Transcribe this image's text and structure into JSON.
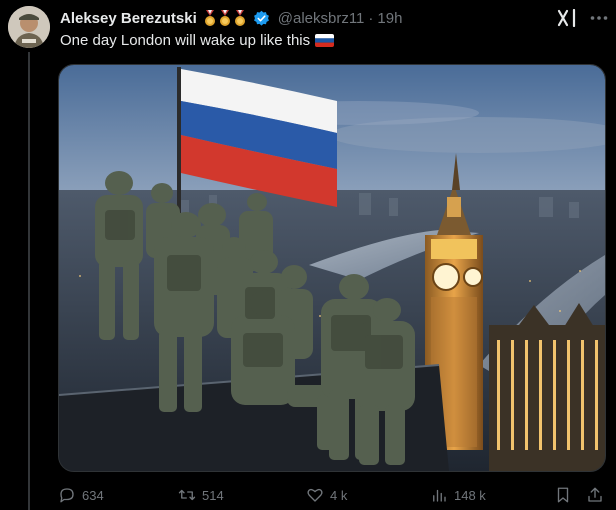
{
  "post": {
    "author_name": "Aleksey Berezutski",
    "handle": "@aleksbrz11",
    "separator": "·",
    "time": "19h",
    "text": "One day London will wake up like this",
    "text_flag_icon": "russian-flag-emoji",
    "badges": [
      "medal-icon",
      "medal-icon",
      "medal-icon"
    ],
    "verified_icon": "verified-badge-icon"
  },
  "image": {
    "description_icon": "ai-generated-photo"
  },
  "actions": {
    "replies": "634",
    "reposts": "514",
    "likes": "4 k",
    "views": "148 k"
  },
  "colors": {
    "background": "#000000",
    "text": "#e7e9ea",
    "muted": "#71767b",
    "verified": "#1d9bf0"
  }
}
